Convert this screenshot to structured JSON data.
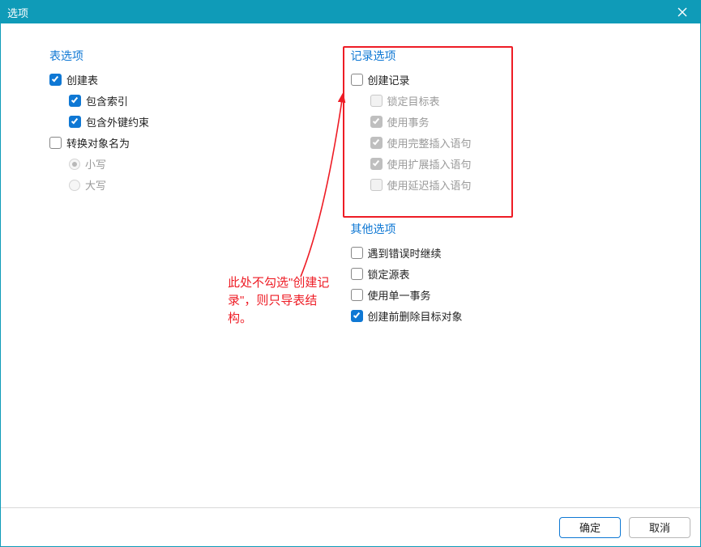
{
  "window": {
    "title": "选项"
  },
  "table": {
    "heading": "表选项",
    "createTable": "创建表",
    "includeIndex": "包含索引",
    "includeFK": "包含外键约束",
    "convertName": "转换对象名为",
    "lower": "小写",
    "upper": "大写"
  },
  "record": {
    "heading": "记录选项",
    "createRecord": "创建记录",
    "lockTarget": "锁定目标表",
    "useTxn": "使用事务",
    "useFullInsert": "使用完整插入语句",
    "useExtInsert": "使用扩展插入语句",
    "useDelayedInsert": "使用延迟插入语句"
  },
  "other": {
    "heading": "其他选项",
    "continueOnError": "遇到错误时继续",
    "lockSource": "锁定源表",
    "singleTxn": "使用单一事务",
    "dropBefore": "创建前删除目标对象"
  },
  "annotation": {
    "text": "此处不勾选\"创建记录\"，则只导表结构。"
  },
  "buttons": {
    "ok": "确定",
    "cancel": "取消"
  }
}
